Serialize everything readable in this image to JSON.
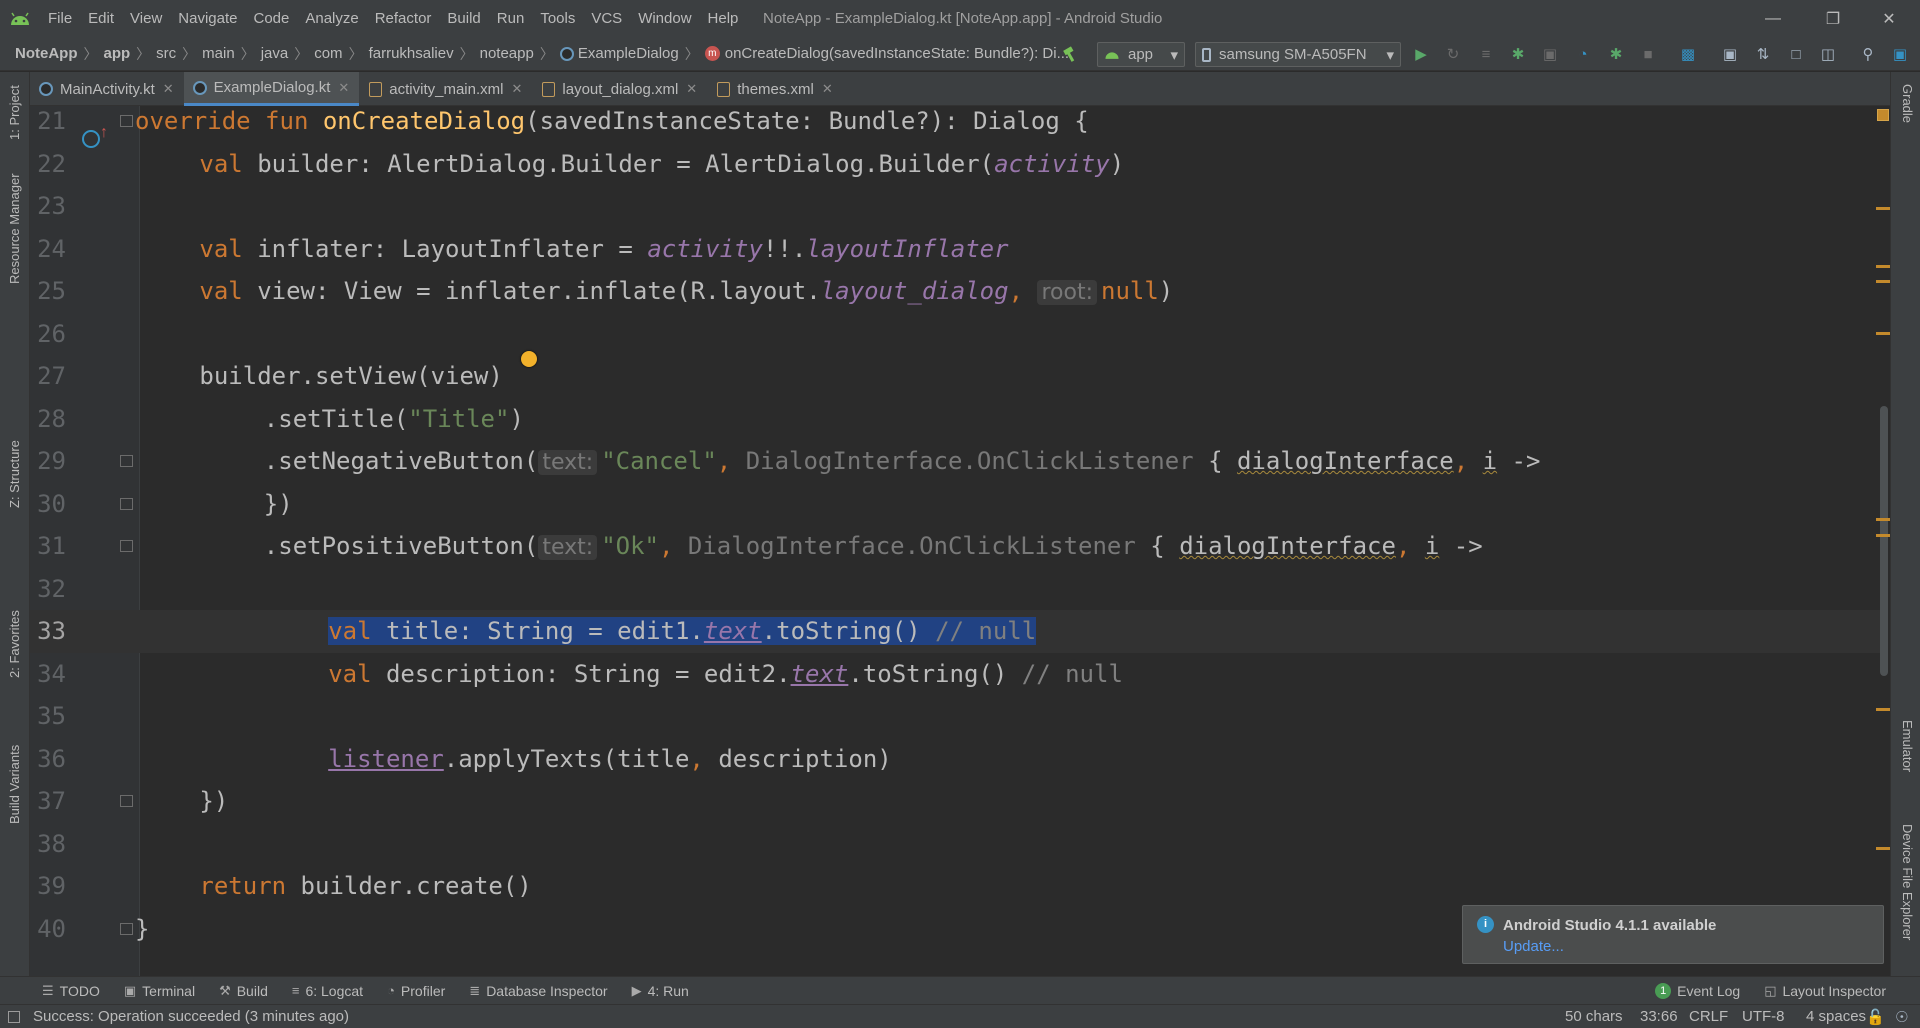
{
  "window": {
    "title": "NoteApp - ExampleDialog.kt [NoteApp.app] - Android Studio",
    "menu": [
      "File",
      "Edit",
      "View",
      "Navigate",
      "Code",
      "Analyze",
      "Refactor",
      "Build",
      "Run",
      "Tools",
      "VCS",
      "Window",
      "Help"
    ]
  },
  "navbar": {
    "crumbs": [
      "NoteApp",
      "app",
      "src",
      "main",
      "java",
      "com",
      "farrukhsaliev",
      "noteapp",
      "ExampleDialog",
      "onCreateDialog(savedInstanceState: Bundle?): Di..."
    ],
    "run_config": "app",
    "device": "samsung SM-A505FN"
  },
  "tabs": [
    {
      "label": "MainActivity.kt",
      "type": "kt",
      "active": false
    },
    {
      "label": "ExampleDialog.kt",
      "type": "kt",
      "active": true
    },
    {
      "label": "activity_main.xml",
      "type": "xml",
      "active": false
    },
    {
      "label": "layout_dialog.xml",
      "type": "xml",
      "active": false
    },
    {
      "label": "themes.xml",
      "type": "xml",
      "active": false
    }
  ],
  "left_tools": [
    "1: Project",
    "Resource Manager",
    "Z: Structure",
    "2: Favorites",
    "Build Variants"
  ],
  "right_tools": [
    "Gradle",
    "Emulator",
    "Device File Explorer"
  ],
  "editor": {
    "current_line": 33,
    "lines": [
      {
        "n": 21,
        "indent": 0,
        "tokens": [
          [
            "kw",
            "override fun "
          ],
          [
            "fn",
            "onCreateDialog"
          ],
          [
            "",
            "(savedInstanceState: Bundle?): Dialog {"
          ]
        ]
      },
      {
        "n": 22,
        "indent": 4,
        "tokens": [
          [
            "kw",
            "val "
          ],
          [
            "",
            "builder: AlertDialog.Builder = AlertDialog.Builder("
          ],
          [
            "it",
            "activity"
          ],
          [
            "",
            ")"
          ]
        ]
      },
      {
        "n": 23,
        "indent": 0,
        "tokens": []
      },
      {
        "n": 24,
        "indent": 4,
        "tokens": [
          [
            "kw",
            "val "
          ],
          [
            "",
            "inflater: LayoutInflater = "
          ],
          [
            "it",
            "activity"
          ],
          [
            "",
            "!!."
          ],
          [
            "it",
            "layoutInflater"
          ]
        ]
      },
      {
        "n": 25,
        "indent": 4,
        "tokens": [
          [
            "kw",
            "val "
          ],
          [
            "",
            "view: View = inflater.inflate(R.layout."
          ],
          [
            "it",
            "layout_dialog"
          ],
          [
            "kw",
            ", "
          ],
          [
            "hint",
            "root:"
          ],
          [
            "kw",
            "null"
          ],
          [
            "",
            ")"
          ]
        ]
      },
      {
        "n": 26,
        "indent": 0,
        "tokens": []
      },
      {
        "n": 27,
        "indent": 4,
        "tokens": [
          [
            "",
            "builder.setView(view)"
          ]
        ]
      },
      {
        "n": 28,
        "indent": 8,
        "tokens": [
          [
            "",
            ".setTitle("
          ],
          [
            "str",
            "\"Title\""
          ],
          [
            "",
            ")"
          ]
        ]
      },
      {
        "n": 29,
        "indent": 8,
        "tokens": [
          [
            "",
            ".setNegativeButton("
          ],
          [
            "hint",
            "text:"
          ],
          [
            "str",
            "\"Cancel\""
          ],
          [
            "kw",
            ", "
          ],
          [
            "gray",
            "DialogInterface.OnClickListener"
          ],
          [
            "",
            " { "
          ],
          [
            "warn",
            "dialogInterface"
          ],
          [
            "kw",
            ", "
          ],
          [
            "warn",
            "i"
          ],
          [
            "",
            " ->"
          ]
        ]
      },
      {
        "n": 30,
        "indent": 8,
        "tokens": [
          [
            "",
            "})"
          ]
        ]
      },
      {
        "n": 31,
        "indent": 8,
        "tokens": [
          [
            "",
            ".setPositiveButton("
          ],
          [
            "hint",
            "text:"
          ],
          [
            "str",
            "\"Ok\""
          ],
          [
            "kw",
            ", "
          ],
          [
            "gray",
            "DialogInterface.OnClickListener"
          ],
          [
            "",
            " { "
          ],
          [
            "warn",
            "dialogInterface"
          ],
          [
            "kw",
            ", "
          ],
          [
            "warn",
            "i"
          ],
          [
            "",
            " ->"
          ]
        ]
      },
      {
        "n": 32,
        "indent": 0,
        "tokens": []
      },
      {
        "n": 33,
        "indent": 12,
        "tokens": [
          [
            "kw sel",
            "val "
          ],
          [
            "sel",
            "title: String = edit1."
          ],
          [
            "pr ul it sel",
            "text"
          ],
          [
            "sel",
            ".toString() "
          ],
          [
            "cm sel",
            "// null"
          ]
        ]
      },
      {
        "n": 34,
        "indent": 12,
        "tokens": [
          [
            "kw",
            "val "
          ],
          [
            "",
            "description: String = edit2."
          ],
          [
            "pr ul it",
            "text"
          ],
          [
            "",
            ".toString() "
          ],
          [
            "cm",
            "// null"
          ]
        ]
      },
      {
        "n": 35,
        "indent": 0,
        "tokens": []
      },
      {
        "n": 36,
        "indent": 12,
        "tokens": [
          [
            "pr ul",
            "listener"
          ],
          [
            "",
            ".applyTexts(title"
          ],
          [
            "kw",
            ", "
          ],
          [
            "",
            "description)"
          ]
        ]
      },
      {
        "n": 37,
        "indent": 4,
        "tokens": [
          [
            "",
            "})"
          ]
        ]
      },
      {
        "n": 38,
        "indent": 0,
        "tokens": []
      },
      {
        "n": 39,
        "indent": 4,
        "tokens": [
          [
            "kw",
            "return "
          ],
          [
            "",
            "builder.create()"
          ]
        ]
      },
      {
        "n": 40,
        "indent": 0,
        "tokens": [
          [
            "",
            "}"
          ]
        ]
      }
    ]
  },
  "notification": {
    "title": "Android Studio 4.1.1 available",
    "link": "Update..."
  },
  "bottom_tools": [
    {
      "label": "TODO",
      "icon": "list-icon"
    },
    {
      "label": "Terminal",
      "icon": "terminal-icon"
    },
    {
      "label": "Build",
      "icon": "hammer-icon"
    },
    {
      "label": "6: Logcat",
      "icon": "logcat-icon"
    },
    {
      "label": "Profiler",
      "icon": "profiler-icon"
    },
    {
      "label": "Database Inspector",
      "icon": "database-icon"
    },
    {
      "label": "4: Run",
      "icon": "run-icon"
    }
  ],
  "bottom_right_tools": [
    {
      "label": "Event Log",
      "badge": "1"
    },
    {
      "label": "Layout Inspector"
    }
  ],
  "status": {
    "message": "Success: Operation succeeded (3 minutes ago)",
    "chars": "50 chars",
    "position": "33:66",
    "line_sep": "CRLF",
    "encoding": "UTF-8",
    "indent": "4 spaces"
  },
  "colors": {
    "accent": "#4a88c7",
    "keyword": "#cc7832",
    "function": "#ffc66d",
    "string": "#6a8759",
    "property": "#9876aa",
    "selection": "#214283"
  }
}
